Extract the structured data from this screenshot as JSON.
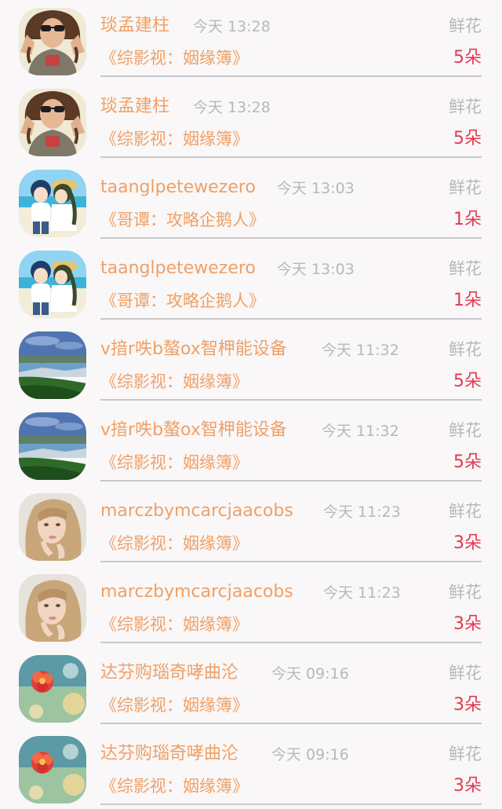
{
  "gift_records": [
    {
      "name": "琰孟建柱",
      "time": "今天 13:28",
      "kind": "鲜花",
      "book": "《综影视：姻缘簿》",
      "count": "5朵",
      "avatar": "woman-sunglasses-avatar"
    },
    {
      "name": "琰孟建柱",
      "time": "今天 13:28",
      "kind": "鲜花",
      "book": "《综影视：姻缘簿》",
      "count": "5朵",
      "avatar": "woman-sunglasses-avatar"
    },
    {
      "name": "taanglpetewezero",
      "time": "今天 13:03",
      "kind": "鲜花",
      "book": "《哥谭：攻略企鹅人》",
      "count": "1朵",
      "avatar": "anime-couple-beach-avatar"
    },
    {
      "name": "taanglpetewezero",
      "time": "今天 13:03",
      "kind": "鲜花",
      "book": "《哥谭：攻略企鹅人》",
      "count": "1朵",
      "avatar": "anime-couple-beach-avatar"
    },
    {
      "name": "v揞r呹b螯ox智柙能设备",
      "time": "今天 11:32",
      "kind": "鲜花",
      "book": "《综影视：姻缘簿》",
      "count": "5朵",
      "avatar": "coastal-landscape-avatar"
    },
    {
      "name": "v揞r呹b螯ox智柙能设备",
      "time": "今天 11:32",
      "kind": "鲜花",
      "book": "《综影视：姻缘簿》",
      "count": "5朵",
      "avatar": "coastal-landscape-avatar"
    },
    {
      "name": "marczbymcarcjaacobs",
      "time": "今天 11:23",
      "kind": "鲜花",
      "book": "《综影视：姻缘簿》",
      "count": "3朵",
      "avatar": "blonde-girl-avatar"
    },
    {
      "name": "marczbymcarcjaacobs",
      "time": "今天 11:23",
      "kind": "鲜花",
      "book": "《综影视：姻缘簿》",
      "count": "3朵",
      "avatar": "blonde-girl-avatar"
    },
    {
      "name": "达芬购瑙奇哮曲沦",
      "time": "今天 09:16",
      "kind": "鲜花",
      "book": "《综影视：姻缘簿》",
      "count": "3朵",
      "avatar": "red-flower-avatar"
    },
    {
      "name": "达芬购瑙奇哮曲沦",
      "time": "今天 09:16",
      "kind": "鲜花",
      "book": "《综影视：姻缘簿》",
      "count": "3朵",
      "avatar": "red-flower-avatar"
    }
  ],
  "colors": {
    "name": "#f0a066",
    "meta": "#b8b8b8",
    "count": "#e23a52",
    "background": "#f9f7f8"
  }
}
